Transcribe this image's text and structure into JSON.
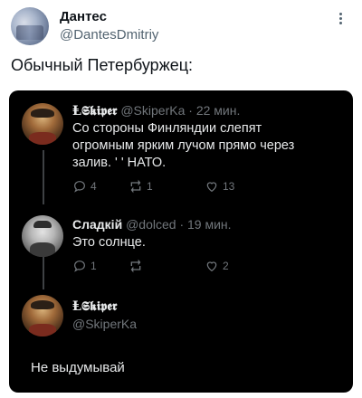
{
  "author": {
    "name": "Дантес",
    "handle": "@DantesDmitriy"
  },
  "tweet_text": "Обычный Петербуржец:",
  "replies": [
    {
      "name": "Ⱡ𝕾𝖐𝖎𝖕𝖊𝖗",
      "handle": "@SkiperKa",
      "sep": "·",
      "time": "22 мин.",
      "text_line1": "Со стороны Финляндии слепят",
      "text_line2": "огромным ярким лучом прямо через",
      "text_line3": "залив. ' ' НАТО.",
      "replies_count": "4",
      "retweets_count": "1",
      "likes_count": "13"
    },
    {
      "name": "Сладкiй",
      "handle": "@dolced",
      "sep": "·",
      "time": "19 мин.",
      "text_line1": "Это солнце.",
      "replies_count": "1",
      "retweets_count": "",
      "likes_count": "2"
    },
    {
      "name": "Ⱡ𝕾𝖐𝖎𝖕𝖊𝖗",
      "handle": "@SkiperKa"
    }
  ],
  "final_text": "Не выдумывай"
}
